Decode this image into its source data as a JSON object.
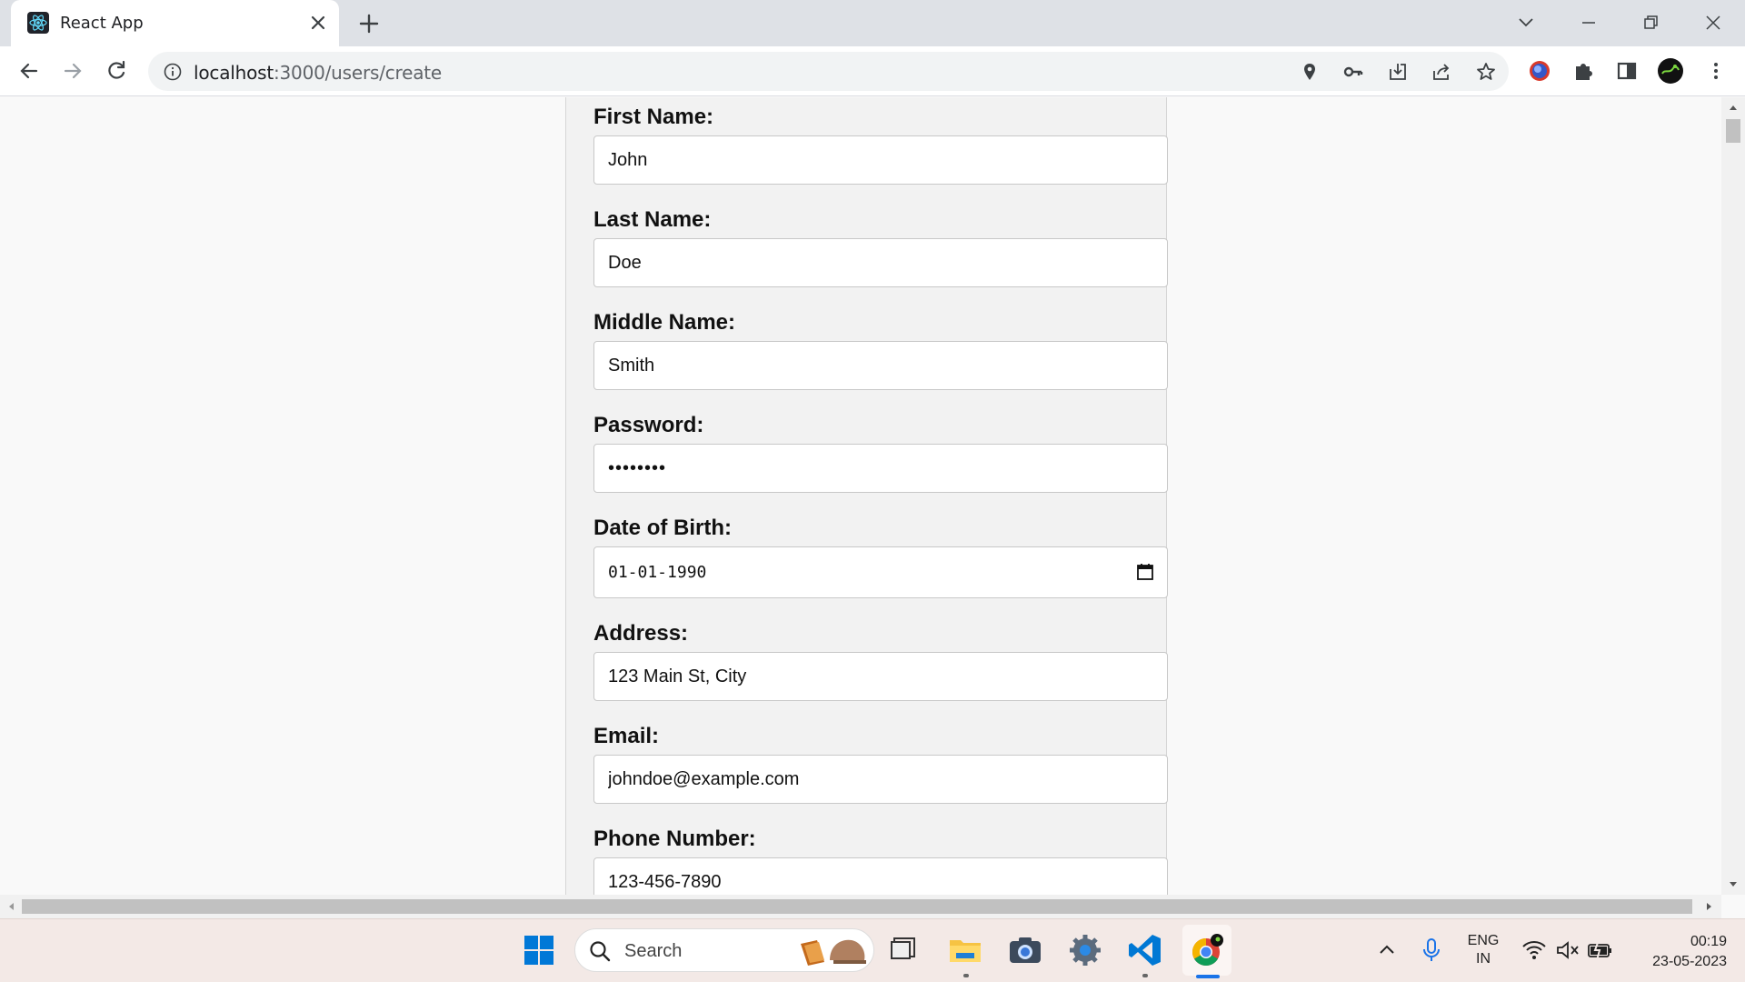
{
  "browser": {
    "tab_title": "React App",
    "url_host": "localhost",
    "url_path": ":3000/users/create"
  },
  "form": {
    "fields": [
      {
        "label": "First Name:",
        "value": "John"
      },
      {
        "label": "Last Name:",
        "value": "Doe"
      },
      {
        "label": "Middle Name:",
        "value": "Smith"
      },
      {
        "label": "Password:",
        "value": "••••••••"
      },
      {
        "label": "Date of Birth:",
        "value": "01-01-1990"
      },
      {
        "label": "Address:",
        "value": "123 Main St, City"
      },
      {
        "label": "Email:",
        "value": "johndoe@example.com"
      },
      {
        "label": "Phone Number:",
        "value": "123-456-7890"
      }
    ]
  },
  "taskbar": {
    "search_placeholder": "Search",
    "language": "ENG",
    "region": "IN",
    "time": "00:19",
    "date": "23-05-2023"
  },
  "colors": {
    "accent": "#1a73e8",
    "vscode_blue": "#0078d4",
    "windows_blue": "#0078d7"
  }
}
